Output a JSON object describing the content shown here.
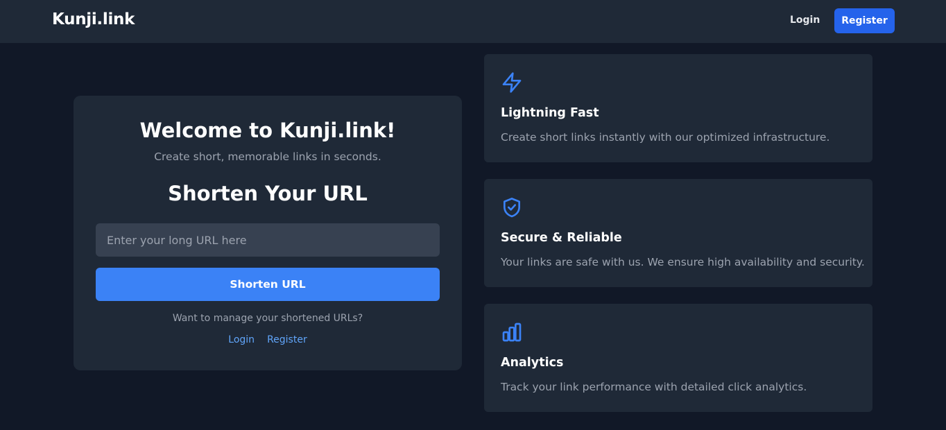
{
  "header": {
    "brand": "Kunji.link",
    "login_label": "Login",
    "register_label": "Register"
  },
  "main": {
    "welcome_title": "Welcome to Kunji.link!",
    "subtitle": "Create short, memorable links in seconds.",
    "shorten_title": "Shorten Your URL",
    "url_input": {
      "value": "",
      "placeholder": "Enter your long URL here"
    },
    "shorten_button": "Shorten URL",
    "manage_text": "Want to manage your shortened URLs?",
    "login_link": "Login",
    "register_link": "Register"
  },
  "features": [
    {
      "icon": "lightning-icon",
      "title": "Lightning Fast",
      "description": "Create short links instantly with our optimized infrastructure."
    },
    {
      "icon": "shield-check-icon",
      "title": "Secure & Reliable",
      "description": "Your links are safe with us. We ensure high availability and security."
    },
    {
      "icon": "bar-chart-icon",
      "title": "Analytics",
      "description": "Track your link performance with detailed click analytics."
    }
  ],
  "colors": {
    "background": "#111827",
    "surface": "#1f2937",
    "input": "#374151",
    "accent": "#3b82f6",
    "accent_dark": "#2563eb",
    "link": "#60a5fa",
    "muted_text": "#9ca3af"
  }
}
